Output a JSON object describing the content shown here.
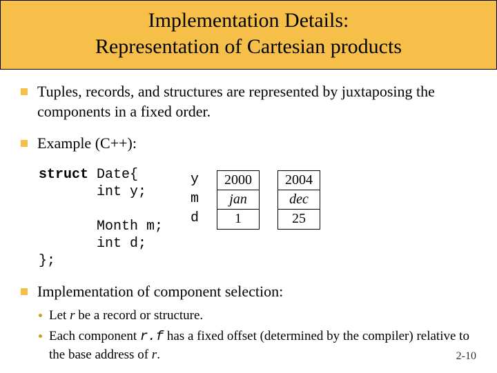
{
  "title": {
    "line1": "Implementation Details:",
    "line2": "Representation of Cartesian products"
  },
  "bullets": {
    "b1": "Tuples, records, and structures are represented by juxtaposing the components in a fixed order.",
    "b2": "Example (C++):",
    "b3": "Implementation of component selection:"
  },
  "code": {
    "kw": "struct",
    "l1": " Date{",
    "l2": "       int y;",
    "l3": "       Month m;",
    "l4": "       int d;",
    "l5": "};"
  },
  "fields": {
    "f1": "y",
    "f2": "m",
    "f3": "d"
  },
  "table1": {
    "r1": "2000",
    "r2": "jan",
    "r3": "1"
  },
  "table2": {
    "r1": "2004",
    "r2": "dec",
    "r3": "25"
  },
  "subs": {
    "s1a": "Let ",
    "s1b": "r",
    "s1c": " be a record or structure.",
    "s2a": "Each component ",
    "s2b": "r.f",
    "s2c": " has a fixed offset (determined by the compiler) relative to the base address of ",
    "s2d": "r",
    "s2e": "."
  },
  "slidenum": "2-10"
}
